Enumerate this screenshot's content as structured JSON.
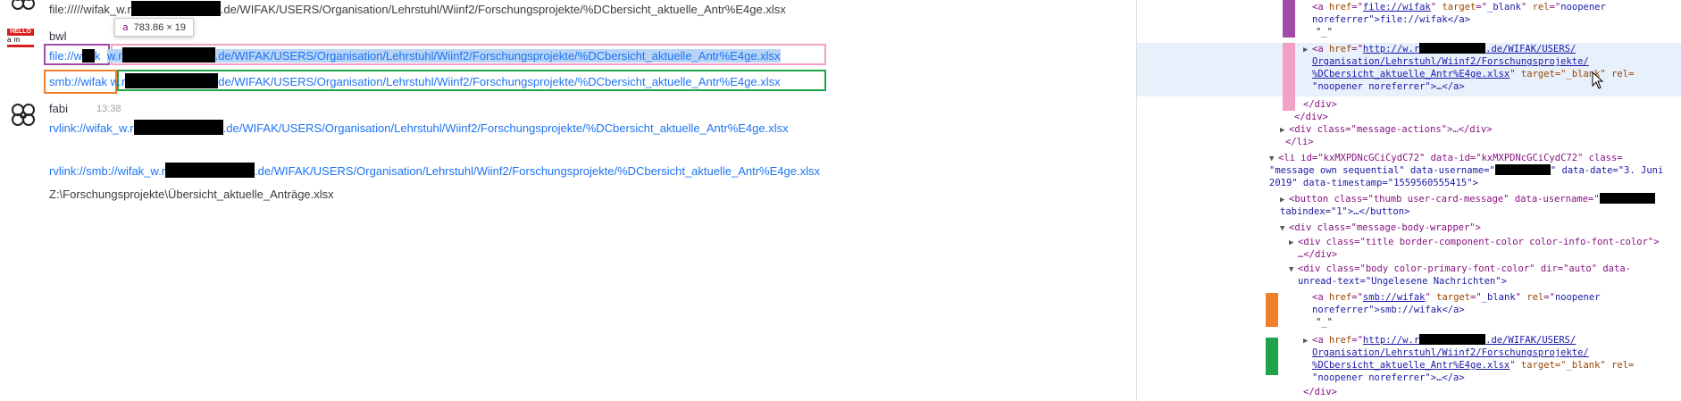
{
  "chat": {
    "messages": [
      {
        "text_prefix": "file://///wifak_w.r",
        "text_suffix": ".de/WIFAK/USERS/Organisation/Lehrstuhl/Wiinf2/Forschungsprojekte/%DCbersicht_aktuelle_Antr%E4ge.xlsx"
      },
      {
        "username": "bwl"
      },
      {
        "link1": "file://w",
        "link1_tail": "k",
        "link2_prefix": "w.r",
        "link2_suffix": ".de/WIFAK/USERS/Organisation/Lehrstuhl/Wiinf2/Forschungsprojekte/%DCbersicht_aktuelle_Antr%E4ge.xlsx"
      },
      {
        "link1": "smb://wifak",
        "link2_prefix": "w.r",
        "link2_suffix": "de/WIFAK/USERS/Organisation/Lehrstuhl/Wiinf2/Forschungsprojekte/%DCbersicht_aktuelle_Antr%E4ge.xlsx"
      },
      {
        "username": "fabi",
        "time": "13:38"
      },
      {
        "text_prefix": "rvlink://wifak_w.r",
        "text_suffix": ".de/WIFAK/USERS/Organisation/Lehrstuhl/Wiinf2/Forschungsprojekte/%DCbersicht_aktuelle_Antr%E4ge.xlsx"
      },
      {
        "text_prefix": "rvlink://smb://wifak_w.r",
        "text_suffix": ".de/WIFAK/USERS/Organisation/Lehrstuhl/Wiinf2/Forschungsprojekte/%DCbersicht_aktuelle_Antr%E4ge.xlsx"
      },
      {
        "text": "Z:\\Forschungsprojekte\\Übersicht_aktuelle_Anträge.xlsx"
      }
    ],
    "tooltip": {
      "tag": "a",
      "size": "783.86 × 19"
    },
    "hello_badge": {
      "top": "HELLO",
      "bottom": "am"
    }
  },
  "devtools": {
    "lines": {
      "l1a": "file://wifak",
      "l1b": "noreferrer\">file://wifak</a>",
      "quote": "\"_\"",
      "l2href": "http://w.r",
      "l2href_b": ".de/WIFAK/USERS/",
      "l2href_c": "Organisation/Lehrstuhl/Wiinf2/Forschungsprojekte/",
      "l2href_d": "%DCbersicht_aktuelle_Antr%E4ge.xlsx",
      "l2tail": "target=\"_blank\" rel=",
      "l2tail2": "\"noopener noreferrer\">…</a>",
      "div_close": "</div>",
      "msg_actions": "<div class=\"message-actions\">…</div>",
      "li_close": "</li>",
      "li_open": "<li id=\"kxMXPDNcGCiCydC72\" data-id=\"kxMXPDNcGCiCydC72\" class=",
      "li_open2": "\"message own sequential\" data-username=\"",
      "li_open2b": "\" data-date=\"3. Juni",
      "li_open3": "2019\" data-timestamp=\"1559560555415\">",
      "button": "<button class=\"thumb user-card-message\" data-username=\"",
      "button2": "tabindex=\"1\">…</button>",
      "wrapper": "<div class=\"message-body-wrapper\">",
      "title": "<div class=\"title border-component-color color-info-font-color\">",
      "title2": "…</div>",
      "body": "<div class=\"body color-primary-font-color\" dir=\"auto\" data-",
      "body2": "unread-text=\"Ungelesene Nachrichten\">",
      "smb_a": "smb://wifak",
      "smb_b": "noreferrer\">smb://wifak</a>",
      "quote2": "\"_\"",
      "h2href": "http://w.r",
      "h2href_b": ".de/WIFAK/USERS/",
      "h2href_c": "Organisation/Lehrstuhl/Wiinf2/Forschungsprojekte/",
      "h2href_d": "%DCbersicht_aktuelle_Antr%E4ge.xlsx",
      "h2tail": "target=\"_blank\" rel=",
      "h2tail2": "\"noopener noreferrer\">…</a>",
      "div_close2": "</div>"
    }
  },
  "colors": {
    "purple": "#a24aa9",
    "pink": "#f2a0c6",
    "orange": "#f07f2a",
    "green": "#1fa24a",
    "link": "#1d74f5"
  }
}
